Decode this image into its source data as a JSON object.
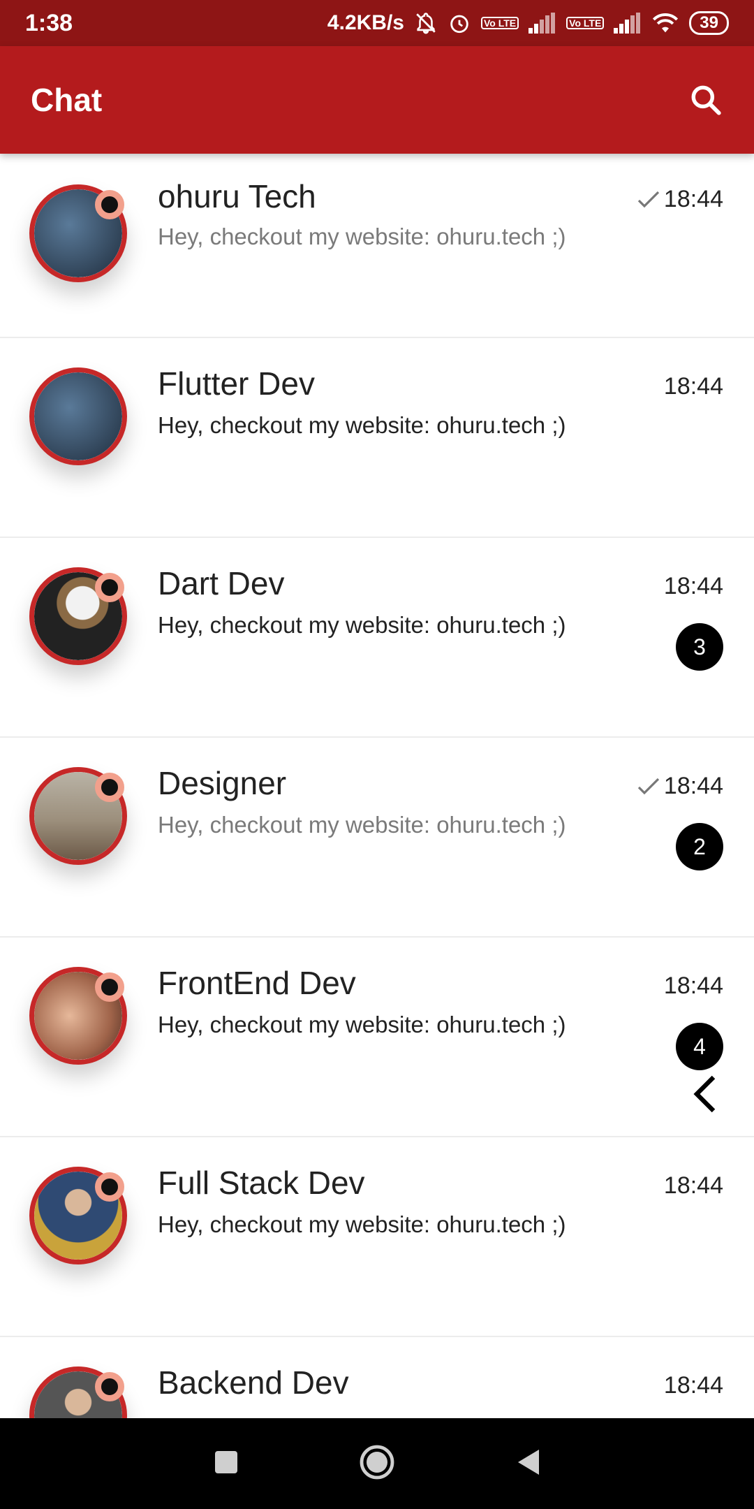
{
  "status_bar": {
    "time": "1:38",
    "net_speed": "4.2KB/s",
    "lte_label": "Vo LTE",
    "battery": "39"
  },
  "app_bar": {
    "title": "Chat",
    "search_icon": "search-icon"
  },
  "chats": [
    {
      "name": "ohuru Tech",
      "message": "Hey, checkout my website: ohuru.tech ;)",
      "time": "18:44",
      "read": true,
      "unread": null,
      "online": true,
      "avatar_color": "#2c3e50"
    },
    {
      "name": "Flutter Dev",
      "message": "Hey, checkout my website: ohuru.tech ;)",
      "time": "18:44",
      "read": false,
      "unread": null,
      "online": false,
      "avatar_color": "#34495e"
    },
    {
      "name": "Dart Dev",
      "message": "Hey, checkout my website: ohuru.tech ;)",
      "time": "18:44",
      "read": false,
      "unread": "3",
      "online": true,
      "avatar_color": "#4a4a4a"
    },
    {
      "name": "Designer",
      "message": "Hey, checkout my website: ohuru.tech ;)",
      "time": "18:44",
      "read": true,
      "unread": "2",
      "online": true,
      "avatar_color": "#8d7b68"
    },
    {
      "name": "FrontEnd Dev",
      "message": "Hey, checkout my website: ohuru.tech ;)",
      "time": "18:44",
      "read": false,
      "unread": "4",
      "online": true,
      "avatar_color": "#b98a6c"
    },
    {
      "name": "Full Stack Dev",
      "message": "Hey, checkout my website: ohuru.tech ;)",
      "time": "18:44",
      "read": false,
      "unread": null,
      "online": true,
      "avatar_color": "#3f5f86"
    },
    {
      "name": "Backend Dev",
      "message": "",
      "time": "18:44",
      "read": false,
      "unread": null,
      "online": true,
      "avatar_color": "#555555"
    }
  ],
  "colors": {
    "status_bar": "#8e1515",
    "app_bar": "#b41b1d",
    "avatar_ring": "#c62828",
    "online_ring": "#f2a08c"
  },
  "nav": {
    "recents": "square-icon",
    "home": "circle-icon",
    "back": "triangle-back-icon"
  }
}
